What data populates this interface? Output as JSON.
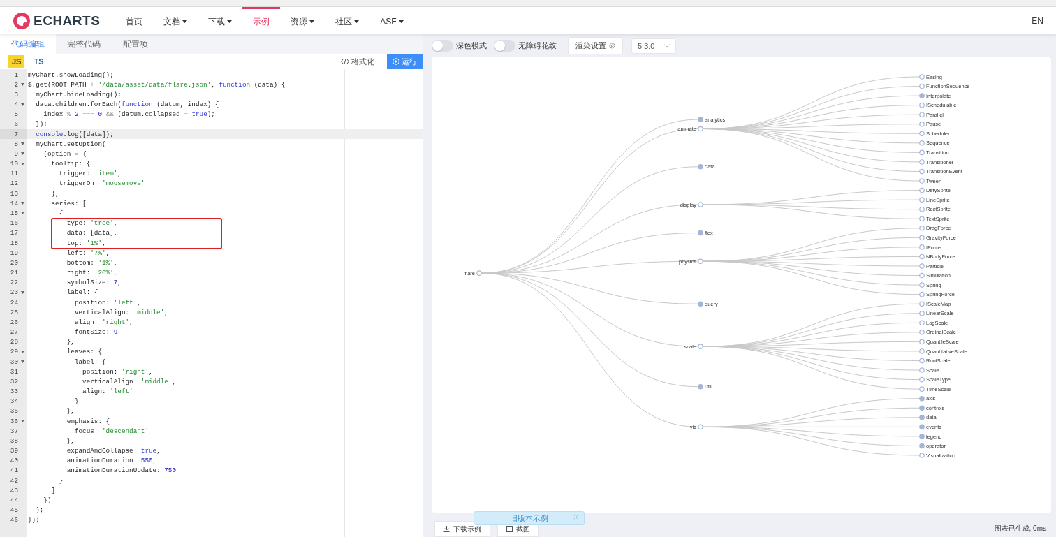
{
  "nav": {
    "logo": "ECHARTS",
    "items": [
      {
        "label": "首页",
        "dropdown": false,
        "selected": false
      },
      {
        "label": "文档",
        "dropdown": true,
        "selected": false
      },
      {
        "label": "下载",
        "dropdown": true,
        "selected": false
      },
      {
        "label": "示例",
        "dropdown": false,
        "selected": true
      },
      {
        "label": "资源",
        "dropdown": true,
        "selected": false
      },
      {
        "label": "社区",
        "dropdown": true,
        "selected": false
      },
      {
        "label": "ASF",
        "dropdown": true,
        "selected": false
      }
    ],
    "language": "EN"
  },
  "editor": {
    "tabs": [
      {
        "label": "代码编辑",
        "selected": true
      },
      {
        "label": "完整代码",
        "selected": false
      },
      {
        "label": "配置项",
        "selected": false
      }
    ],
    "languages": [
      {
        "label": "JS",
        "selected": true
      },
      {
        "label": "TS",
        "selected": false
      }
    ],
    "format_button": "格式化",
    "run_button": "运行",
    "lines": [
      {
        "n": "1",
        "foldable": false,
        "selected": false,
        "boxed": false,
        "code": [
          {
            "kind": "plain",
            "text": "myChart.showLoading();"
          }
        ]
      },
      {
        "n": "2",
        "foldable": true,
        "selected": false,
        "boxed": false,
        "code": [
          {
            "kind": "plain",
            "text": "$.get(ROOT_PATH "
          },
          {
            "kind": "operator",
            "text": "+"
          },
          {
            "kind": "string",
            "text": " '/data/asset/data/flare.json'"
          },
          {
            "kind": "plain",
            "text": ", "
          },
          {
            "kind": "keyword",
            "text": "function"
          },
          {
            "kind": "plain",
            "text": " (data) {"
          }
        ]
      },
      {
        "n": "3",
        "foldable": false,
        "selected": false,
        "boxed": false,
        "code": [
          {
            "kind": "plain",
            "text": "  myChart.hideLoading();"
          }
        ]
      },
      {
        "n": "4",
        "foldable": true,
        "selected": false,
        "boxed": false,
        "code": [
          {
            "kind": "plain",
            "text": "  data.children.forEach("
          },
          {
            "kind": "keyword",
            "text": "function"
          },
          {
            "kind": "plain",
            "text": " (datum, index) {"
          }
        ]
      },
      {
        "n": "5",
        "foldable": false,
        "selected": false,
        "boxed": false,
        "code": [
          {
            "kind": "plain",
            "text": "    index "
          },
          {
            "kind": "operator",
            "text": "%"
          },
          {
            "kind": "number",
            "text": " 2 "
          },
          {
            "kind": "operator",
            "text": "==="
          },
          {
            "kind": "number",
            "text": " 0 "
          },
          {
            "kind": "operator",
            "text": "&&"
          },
          {
            "kind": "plain",
            "text": " (datum.collapsed "
          },
          {
            "kind": "operator",
            "text": "="
          },
          {
            "kind": "keyword",
            "text": " true"
          },
          {
            "kind": "plain",
            "text": ");"
          }
        ]
      },
      {
        "n": "6",
        "foldable": false,
        "selected": false,
        "boxed": false,
        "code": [
          {
            "kind": "plain",
            "text": "  });"
          }
        ]
      },
      {
        "n": "7",
        "foldable": false,
        "selected": true,
        "boxed": false,
        "code": [
          {
            "kind": "keyword",
            "text": "  console"
          },
          {
            "kind": "plain",
            "text": ".log([data]);"
          }
        ]
      },
      {
        "n": "8",
        "foldable": true,
        "selected": false,
        "boxed": false,
        "code": [
          {
            "kind": "plain",
            "text": "  myChart.setOption("
          }
        ]
      },
      {
        "n": "9",
        "foldable": true,
        "selected": false,
        "boxed": false,
        "code": [
          {
            "kind": "plain",
            "text": "    (option "
          },
          {
            "kind": "operator",
            "text": "="
          },
          {
            "kind": "plain",
            "text": " {"
          }
        ]
      },
      {
        "n": "10",
        "foldable": true,
        "selected": false,
        "boxed": false,
        "code": [
          {
            "kind": "plain",
            "text": "      tooltip: {"
          }
        ]
      },
      {
        "n": "11",
        "foldable": false,
        "selected": false,
        "boxed": false,
        "code": [
          {
            "kind": "plain",
            "text": "        trigger: "
          },
          {
            "kind": "string",
            "text": "'item'"
          },
          {
            "kind": "plain",
            "text": ","
          }
        ]
      },
      {
        "n": "12",
        "foldable": false,
        "selected": false,
        "boxed": false,
        "code": [
          {
            "kind": "plain",
            "text": "        triggerOn: "
          },
          {
            "kind": "string",
            "text": "'mousemove'"
          }
        ]
      },
      {
        "n": "13",
        "foldable": false,
        "selected": false,
        "boxed": false,
        "code": [
          {
            "kind": "plain",
            "text": "      },"
          }
        ]
      },
      {
        "n": "14",
        "foldable": true,
        "selected": false,
        "boxed": false,
        "code": [
          {
            "kind": "plain",
            "text": "      series: ["
          }
        ]
      },
      {
        "n": "15",
        "foldable": true,
        "selected": false,
        "boxed": false,
        "code": [
          {
            "kind": "plain",
            "text": "        {"
          }
        ]
      },
      {
        "n": "16",
        "foldable": false,
        "selected": false,
        "boxed": true,
        "code": [
          {
            "kind": "plain",
            "text": "          type: "
          },
          {
            "kind": "string",
            "text": "'tree'"
          },
          {
            "kind": "plain",
            "text": ","
          }
        ]
      },
      {
        "n": "17",
        "foldable": false,
        "selected": false,
        "boxed": true,
        "code": [
          {
            "kind": "plain",
            "text": "          data: [data],"
          }
        ]
      },
      {
        "n": "18",
        "foldable": false,
        "selected": false,
        "boxed": true,
        "code": [
          {
            "kind": "plain",
            "text": "          top: "
          },
          {
            "kind": "string",
            "text": "'1%'"
          },
          {
            "kind": "plain",
            "text": ","
          }
        ]
      },
      {
        "n": "19",
        "foldable": false,
        "selected": false,
        "boxed": false,
        "code": [
          {
            "kind": "plain",
            "text": "          left: "
          },
          {
            "kind": "string",
            "text": "'7%'"
          },
          {
            "kind": "plain",
            "text": ","
          }
        ]
      },
      {
        "n": "20",
        "foldable": false,
        "selected": false,
        "boxed": false,
        "code": [
          {
            "kind": "plain",
            "text": "          bottom: "
          },
          {
            "kind": "string",
            "text": "'1%'"
          },
          {
            "kind": "plain",
            "text": ","
          }
        ]
      },
      {
        "n": "21",
        "foldable": false,
        "selected": false,
        "boxed": false,
        "code": [
          {
            "kind": "plain",
            "text": "          right: "
          },
          {
            "kind": "string",
            "text": "'20%'"
          },
          {
            "kind": "plain",
            "text": ","
          }
        ]
      },
      {
        "n": "22",
        "foldable": false,
        "selected": false,
        "boxed": false,
        "code": [
          {
            "kind": "plain",
            "text": "          symbolSize: "
          },
          {
            "kind": "number",
            "text": "7"
          },
          {
            "kind": "plain",
            "text": ","
          }
        ]
      },
      {
        "n": "23",
        "foldable": true,
        "selected": false,
        "boxed": false,
        "code": [
          {
            "kind": "plain",
            "text": "          label: {"
          }
        ]
      },
      {
        "n": "24",
        "foldable": false,
        "selected": false,
        "boxed": false,
        "code": [
          {
            "kind": "plain",
            "text": "            position: "
          },
          {
            "kind": "string",
            "text": "'left'"
          },
          {
            "kind": "plain",
            "text": ","
          }
        ]
      },
      {
        "n": "25",
        "foldable": false,
        "selected": false,
        "boxed": false,
        "code": [
          {
            "kind": "plain",
            "text": "            verticalAlign: "
          },
          {
            "kind": "string",
            "text": "'middle'"
          },
          {
            "kind": "plain",
            "text": ","
          }
        ]
      },
      {
        "n": "26",
        "foldable": false,
        "selected": false,
        "boxed": false,
        "code": [
          {
            "kind": "plain",
            "text": "            align: "
          },
          {
            "kind": "string",
            "text": "'right'"
          },
          {
            "kind": "plain",
            "text": ","
          }
        ]
      },
      {
        "n": "27",
        "foldable": false,
        "selected": false,
        "boxed": false,
        "code": [
          {
            "kind": "plain",
            "text": "            fontSize: "
          },
          {
            "kind": "number",
            "text": "9"
          }
        ]
      },
      {
        "n": "28",
        "foldable": false,
        "selected": false,
        "boxed": false,
        "code": [
          {
            "kind": "plain",
            "text": "          },"
          }
        ]
      },
      {
        "n": "29",
        "foldable": true,
        "selected": false,
        "boxed": false,
        "code": [
          {
            "kind": "plain",
            "text": "          leaves: {"
          }
        ]
      },
      {
        "n": "30",
        "foldable": true,
        "selected": false,
        "boxed": false,
        "code": [
          {
            "kind": "plain",
            "text": "            label: {"
          }
        ]
      },
      {
        "n": "31",
        "foldable": false,
        "selected": false,
        "boxed": false,
        "code": [
          {
            "kind": "plain",
            "text": "              position: "
          },
          {
            "kind": "string",
            "text": "'right'"
          },
          {
            "kind": "plain",
            "text": ","
          }
        ]
      },
      {
        "n": "32",
        "foldable": false,
        "selected": false,
        "boxed": false,
        "code": [
          {
            "kind": "plain",
            "text": "              verticalAlign: "
          },
          {
            "kind": "string",
            "text": "'middle'"
          },
          {
            "kind": "plain",
            "text": ","
          }
        ]
      },
      {
        "n": "33",
        "foldable": false,
        "selected": false,
        "boxed": false,
        "code": [
          {
            "kind": "plain",
            "text": "              align: "
          },
          {
            "kind": "string",
            "text": "'left'"
          }
        ]
      },
      {
        "n": "34",
        "foldable": false,
        "selected": false,
        "boxed": false,
        "code": [
          {
            "kind": "plain",
            "text": "            }"
          }
        ]
      },
      {
        "n": "35",
        "foldable": false,
        "selected": false,
        "boxed": false,
        "code": [
          {
            "kind": "plain",
            "text": "          },"
          }
        ]
      },
      {
        "n": "36",
        "foldable": true,
        "selected": false,
        "boxed": false,
        "code": [
          {
            "kind": "plain",
            "text": "          emphasis: {"
          }
        ]
      },
      {
        "n": "37",
        "foldable": false,
        "selected": false,
        "boxed": false,
        "code": [
          {
            "kind": "plain",
            "text": "            focus: "
          },
          {
            "kind": "string",
            "text": "'descendant'"
          }
        ]
      },
      {
        "n": "38",
        "foldable": false,
        "selected": false,
        "boxed": false,
        "code": [
          {
            "kind": "plain",
            "text": "          },"
          }
        ]
      },
      {
        "n": "39",
        "foldable": false,
        "selected": false,
        "boxed": false,
        "code": [
          {
            "kind": "plain",
            "text": "          expandAndCollapse: "
          },
          {
            "kind": "keyword",
            "text": "true"
          },
          {
            "kind": "plain",
            "text": ","
          }
        ]
      },
      {
        "n": "40",
        "foldable": false,
        "selected": false,
        "boxed": false,
        "code": [
          {
            "kind": "plain",
            "text": "          animationDuration: "
          },
          {
            "kind": "number",
            "text": "550"
          },
          {
            "kind": "plain",
            "text": ","
          }
        ]
      },
      {
        "n": "41",
        "foldable": false,
        "selected": false,
        "boxed": false,
        "code": [
          {
            "kind": "plain",
            "text": "          animationDurationUpdate: "
          },
          {
            "kind": "number",
            "text": "750"
          }
        ]
      },
      {
        "n": "42",
        "foldable": false,
        "selected": false,
        "boxed": false,
        "code": [
          {
            "kind": "plain",
            "text": "        }"
          }
        ]
      },
      {
        "n": "43",
        "foldable": false,
        "selected": false,
        "boxed": false,
        "code": [
          {
            "kind": "plain",
            "text": "      ]"
          }
        ]
      },
      {
        "n": "44",
        "foldable": false,
        "selected": false,
        "boxed": false,
        "code": [
          {
            "kind": "plain",
            "text": "    })"
          }
        ]
      },
      {
        "n": "45",
        "foldable": false,
        "selected": false,
        "boxed": false,
        "code": [
          {
            "kind": "plain",
            "text": "  );"
          }
        ]
      },
      {
        "n": "46",
        "foldable": false,
        "selected": false,
        "boxed": false,
        "code": [
          {
            "kind": "plain",
            "text": "});"
          }
        ]
      }
    ]
  },
  "preview": {
    "toggles": [
      {
        "label": "深色模式",
        "on": false
      },
      {
        "label": "无障碍花纹",
        "on": false
      }
    ],
    "render_button": "渲染设置",
    "version": "5.3.0",
    "tree": {
      "name": "flare",
      "collapsed": false,
      "children": [
        {
          "name": "analytics",
          "collapsed": true
        },
        {
          "name": "animate",
          "collapsed": false,
          "children": [
            {
              "name": "Easing",
              "collapsed": false
            },
            {
              "name": "FunctionSequence",
              "collapsed": false
            },
            {
              "name": "Interpolate",
              "collapsed": true
            },
            {
              "name": "ISchedulable",
              "collapsed": false
            },
            {
              "name": "Parallel",
              "collapsed": false
            },
            {
              "name": "Pause",
              "collapsed": false
            },
            {
              "name": "Scheduler",
              "collapsed": false
            },
            {
              "name": "Sequence",
              "collapsed": false
            },
            {
              "name": "Transition",
              "collapsed": false
            },
            {
              "name": "Transitioner",
              "collapsed": false
            },
            {
              "name": "TransitionEvent",
              "collapsed": false
            },
            {
              "name": "Tween",
              "collapsed": false
            }
          ]
        },
        {
          "name": "data",
          "collapsed": true
        },
        {
          "name": "display",
          "collapsed": false,
          "children": [
            {
              "name": "DirtySprite",
              "collapsed": false
            },
            {
              "name": "LineSprite",
              "collapsed": false
            },
            {
              "name": "RectSprite",
              "collapsed": false
            },
            {
              "name": "TextSprite",
              "collapsed": false
            }
          ]
        },
        {
          "name": "flex",
          "collapsed": true
        },
        {
          "name": "physics",
          "collapsed": false,
          "children": [
            {
              "name": "DragForce",
              "collapsed": false
            },
            {
              "name": "GravityForce",
              "collapsed": false
            },
            {
              "name": "IForce",
              "collapsed": false
            },
            {
              "name": "NBodyForce",
              "collapsed": false
            },
            {
              "name": "Particle",
              "collapsed": false
            },
            {
              "name": "Simulation",
              "collapsed": false
            },
            {
              "name": "Spring",
              "collapsed": false
            },
            {
              "name": "SpringForce",
              "collapsed": false
            }
          ]
        },
        {
          "name": "query",
          "collapsed": true
        },
        {
          "name": "scale",
          "collapsed": false,
          "children": [
            {
              "name": "IScaleMap",
              "collapsed": false
            },
            {
              "name": "LinearScale",
              "collapsed": false
            },
            {
              "name": "LogScale",
              "collapsed": false
            },
            {
              "name": "OrdinalScale",
              "collapsed": false
            },
            {
              "name": "QuantileScale",
              "collapsed": false
            },
            {
              "name": "QuantitativeScale",
              "collapsed": false
            },
            {
              "name": "RootScale",
              "collapsed": false
            },
            {
              "name": "Scale",
              "collapsed": false
            },
            {
              "name": "ScaleType",
              "collapsed": false
            },
            {
              "name": "TimeScale",
              "collapsed": false
            }
          ]
        },
        {
          "name": "util",
          "collapsed": true
        },
        {
          "name": "vis",
          "collapsed": false,
          "children": [
            {
              "name": "axis",
              "collapsed": true
            },
            {
              "name": "controls",
              "collapsed": true
            },
            {
              "name": "data",
              "collapsed": true
            },
            {
              "name": "events",
              "collapsed": true
            },
            {
              "name": "legend",
              "collapsed": true
            },
            {
              "name": "operator",
              "collapsed": true
            },
            {
              "name": "Visualization",
              "collapsed": false
            }
          ]
        }
      ]
    }
  },
  "footer": {
    "buttons": [
      {
        "label": "下载示例",
        "kind": "download"
      },
      {
        "label": "截图",
        "kind": "screenshot"
      }
    ],
    "toast": {
      "text": "旧版本示例"
    },
    "status": "图表已生成, 0ms"
  }
}
